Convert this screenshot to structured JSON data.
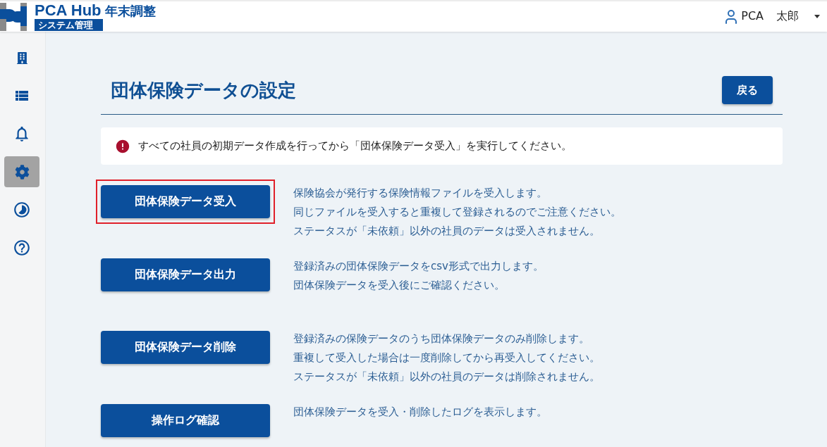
{
  "header": {
    "app_name": "PCA Hub",
    "module": "年末調整",
    "section": "システム管理",
    "user": {
      "last_name": "PCA",
      "first_name": "太郎"
    }
  },
  "sidebar": {
    "items": [
      {
        "kind": "building",
        "selected": false
      },
      {
        "kind": "list",
        "selected": false
      },
      {
        "kind": "bell",
        "selected": false
      },
      {
        "kind": "gear",
        "selected": true
      },
      {
        "kind": "pie",
        "selected": false
      },
      {
        "kind": "help",
        "selected": false
      }
    ]
  },
  "page": {
    "title": "団体保険データの設定",
    "back_button": "戻る"
  },
  "notice": {
    "kind": "error",
    "text": "すべての社員の初期データ作成を行ってから「団体保険データ受入」を実行してください。"
  },
  "actions": [
    {
      "button": "団体保険データ受入",
      "highlighted": true,
      "description": [
        "保険協会が発行する保険情報ファイルを受入します。",
        "同じファイルを受入すると重複して登録されるのでご注意ください。",
        "ステータスが「未依頼」以外の社員のデータは受入されません。"
      ]
    },
    {
      "button": "団体保険データ出力",
      "highlighted": false,
      "description": [
        "登録済みの団体保険データをcsv形式で出力します。",
        "団体保険データを受入後にご確認ください。"
      ]
    },
    {
      "button": "団体保険データ削除",
      "highlighted": false,
      "description": [
        "登録済みの保険データのうち団体保険データのみ削除します。",
        "重複して受入した場合は一度削除してから再受入してください。",
        "ステータスが「未依頼」以外の社員のデータは削除されません。"
      ]
    },
    {
      "button": "操作ログ確認",
      "highlighted": false,
      "description": [
        "団体保険データを受入・削除したログを表示します。"
      ]
    }
  ]
}
